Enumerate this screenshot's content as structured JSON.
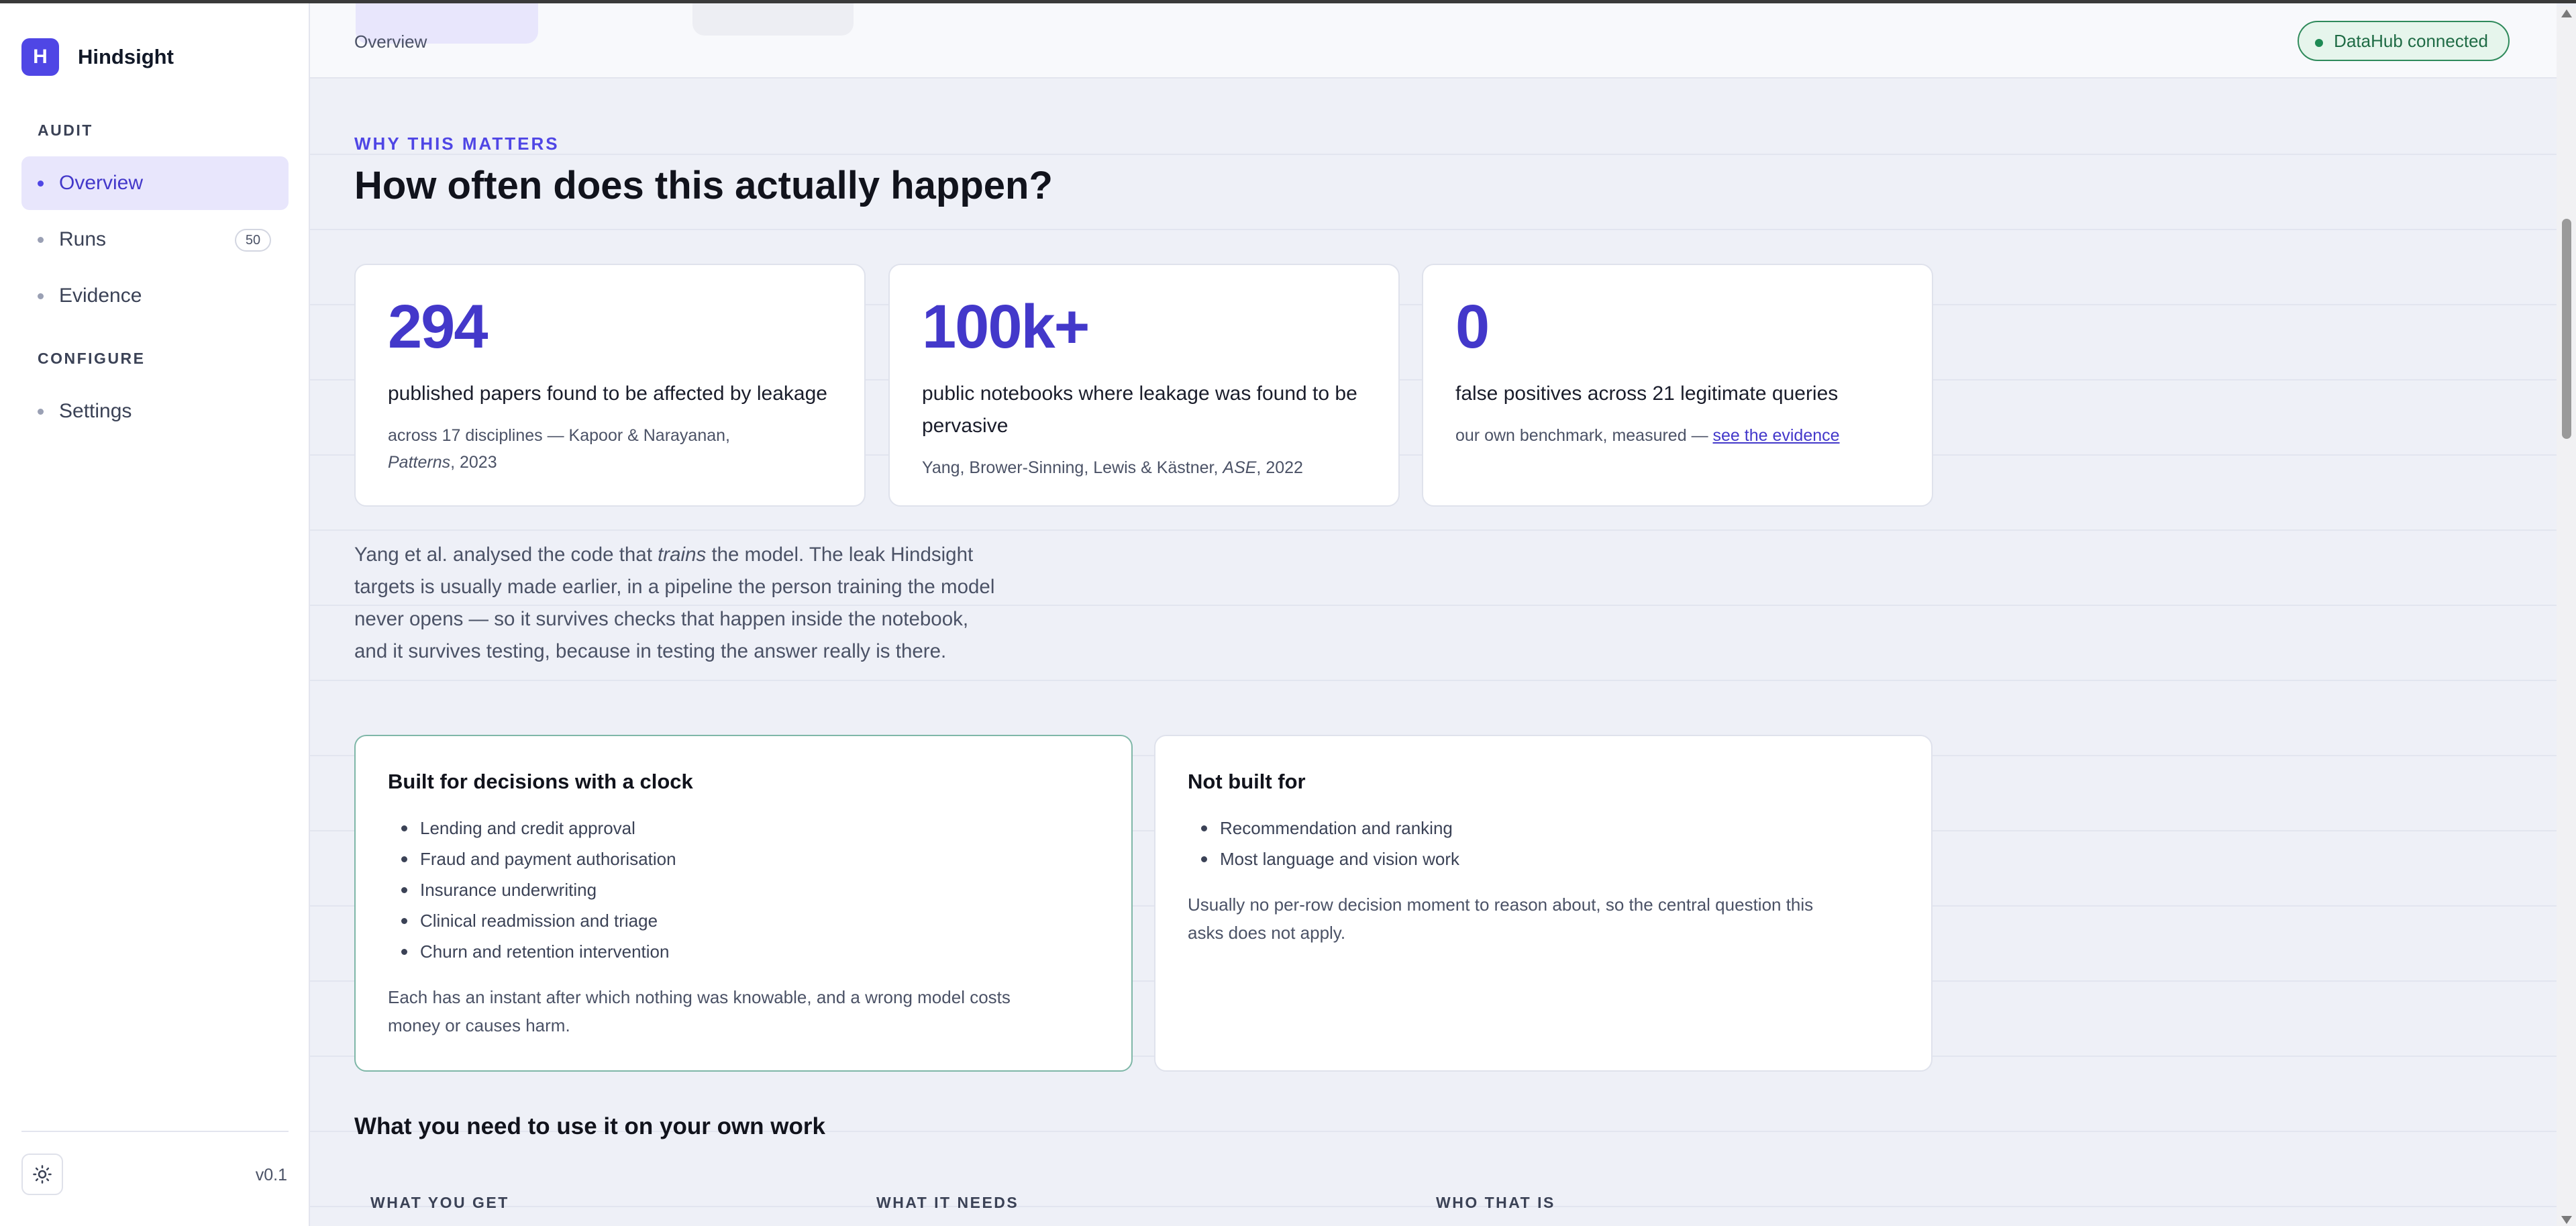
{
  "sidebar": {
    "brand": {
      "logo_letter": "H",
      "name": "Hindsight"
    },
    "sections": [
      {
        "label": "AUDIT"
      },
      {
        "label": "CONFIGURE"
      }
    ],
    "items": [
      {
        "label": "Overview",
        "active": true
      },
      {
        "label": "Runs",
        "badge": "50"
      },
      {
        "label": "Evidence"
      },
      {
        "label": "Settings"
      }
    ],
    "theme_icon": "sun-icon",
    "version": "v0.1"
  },
  "topbar": {
    "breadcrumb": "Overview",
    "status": "DataHub connected",
    "status_color": "#1f8a55"
  },
  "main": {
    "eyebrow": "WHY THIS MATTERS",
    "headline": "How often does this actually happen?",
    "stats": [
      {
        "number": "294",
        "description": "published papers found to be affected by leakage",
        "source_prefix": "across 17 disciplines — Kapoor & Narayanan,",
        "source_italic": "Patterns",
        "source_suffix": ", 2023"
      },
      {
        "number": "100k+",
        "description": "public notebooks where leakage was found to be pervasive",
        "source_prefix": "Yang, Brower-Sinning, Lewis & Kästner, ",
        "source_italic": "ASE",
        "source_suffix": ", 2022"
      },
      {
        "number": "0",
        "description": "false positives across 21 legitimate queries",
        "source_prefix": "our own benchmark, measured — ",
        "source_link": "see the evidence"
      }
    ],
    "prose": {
      "before": "Yang et al. analysed the code that ",
      "italic": "trains",
      "after": " the model. The leak Hindsight targets is usually made earlier, in a pipeline the person training the model never opens — so it survives checks that happen inside the notebook, and it survives testing, because in testing the answer really is there."
    },
    "built_for": {
      "title": "Built for decisions with a clock",
      "items": [
        "Lending and credit approval",
        "Fraud and payment authorisation",
        "Insurance underwriting",
        "Clinical readmission and triage",
        "Churn and retention intervention"
      ],
      "note": "Each has an instant after which nothing was knowable, and a wrong model costs money or causes harm."
    },
    "not_built_for": {
      "title": "Not built for",
      "items": [
        "Recommendation and ranking",
        "Most language and vision work"
      ],
      "note": "Usually no per-row decision moment to reason about, so the central question this asks does not apply."
    },
    "need_heading": "What you need to use it on your own work",
    "columns": [
      "WHAT YOU GET",
      "WHAT IT NEEDS",
      "WHO THAT IS"
    ]
  },
  "colors": {
    "accent": "#4f46e5",
    "accent_dark": "#4338ca",
    "success": "#1f8a55"
  }
}
